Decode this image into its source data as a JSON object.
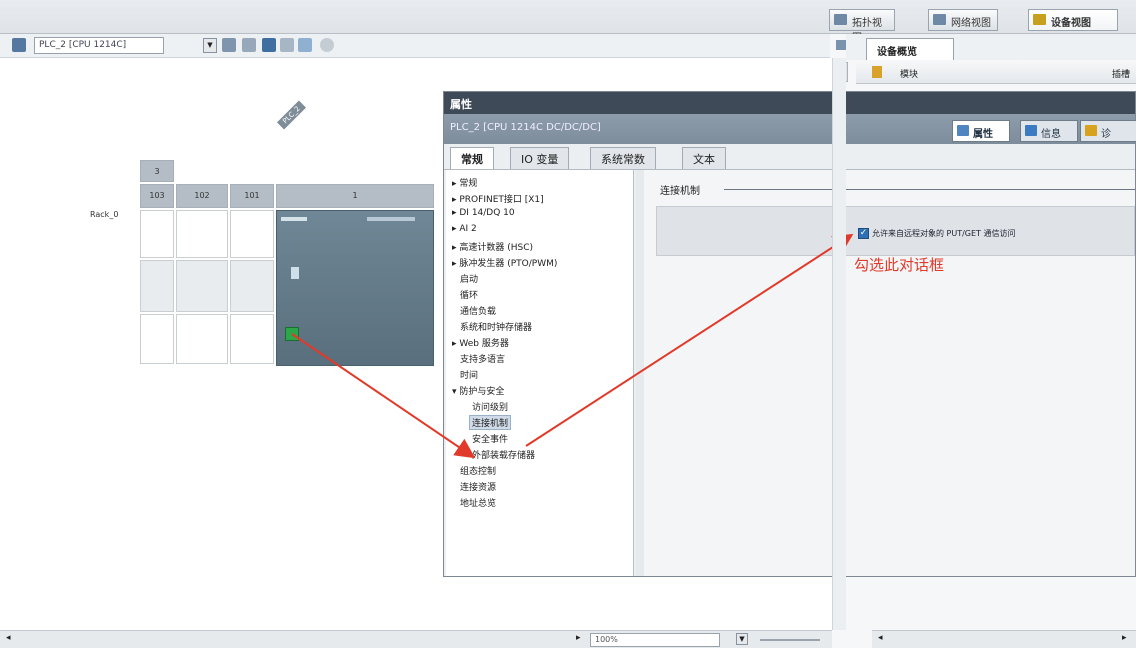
{
  "view_tabs": [
    {
      "label": "拓扑视图",
      "icon": "topology-view-icon"
    },
    {
      "label": "网络视图",
      "icon": "network-view-icon"
    },
    {
      "label": "设备视图",
      "icon": "device-view-icon",
      "active": true
    }
  ],
  "toolbar": {
    "device_select_value": "PLC_2 [CPU 1214C]"
  },
  "rack": {
    "label": "Rack_0",
    "slot_headers": [
      "103",
      "102",
      "101",
      "1"
    ],
    "group_header": "3",
    "plc_tag": "PLC_2"
  },
  "overview": {
    "tab_label": "设备概览",
    "col_module": "模块",
    "col_slot": "插槽"
  },
  "properties": {
    "title": "属性",
    "device": "PLC_2 [CPU 1214C DC/DC/DC]",
    "tabs": [
      {
        "label": "属性",
        "icon": "properties-icon",
        "active": true
      },
      {
        "label": "信息",
        "icon": "info-icon"
      },
      {
        "label": "诊",
        "icon": "diagnostics-icon"
      }
    ],
    "sub_tabs": [
      "常规",
      "IO 变量",
      "系统常数",
      "文本"
    ],
    "nav": [
      "▸ 常规",
      "▸ PROFINET接口 [X1]",
      "▸ DI 14/DQ 10",
      "▸ AI 2",
      "▸ 高速计数器 (HSC)",
      "▸ 脉冲发生器 (PTO/PWM)",
      "启动",
      "循环",
      "通信负载",
      "系统和时钟存储器",
      "▸ Web 服务器",
      "支持多语言",
      "时间",
      "▾ 防护与安全",
      "访问级别",
      "连接机制",
      "安全事件",
      "外部装载存储器",
      "组态控制",
      "连接资源",
      "地址总览"
    ],
    "section_title": "连接机制",
    "checkbox_label": "允许来自远程对象的 PUT/GET 通信访问",
    "checkbox_checked": true,
    "annotation": "勾选此对话框"
  },
  "status": {
    "zoom": "100%"
  }
}
